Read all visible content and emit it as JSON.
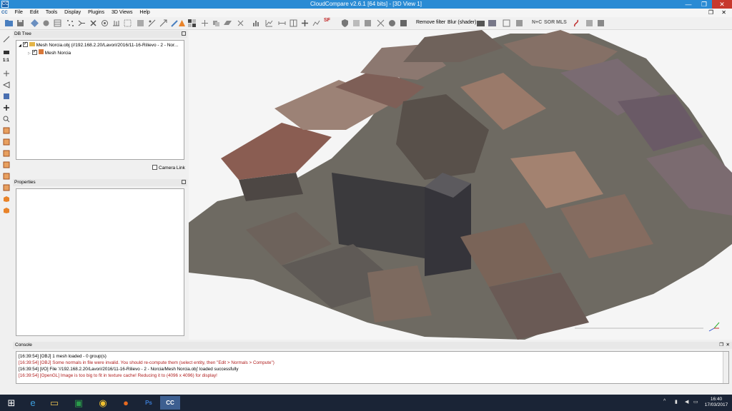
{
  "window": {
    "title": "CloudCompare v2.6.1 [64 bits] - [3D View 1]",
    "app_icon_text": "CC",
    "minimize": "—",
    "maximize": "❐",
    "close": "✕"
  },
  "menu": [
    "File",
    "Edit",
    "Tools",
    "Display",
    "Plugins",
    "3D Views",
    "Help"
  ],
  "toolbar": {
    "remove_filter_label": "Remove filter",
    "blur_shader_label": "Blur (shader)",
    "sf_label": "SF",
    "nc_label": "N+C",
    "sor_label": "SOR",
    "mls_label": "MLS"
  },
  "db_tree": {
    "title": "DB Tree",
    "root_label": "Mesh Norcia.obj (//192.168.2.20/Lavori/2016/11-16-Rilievo - 2 - Nor...",
    "child_label": "Mesh Norcia",
    "camera_link_label": "Camera Link"
  },
  "properties": {
    "title": "Properties"
  },
  "console": {
    "title": "Console",
    "lines": [
      {
        "text": "[16:39:54] [OBJ] 1 mesh loaded - 0 group(s)",
        "level": "info"
      },
      {
        "text": "[16:39:54] [OBJ] Some normals in file were invalid. You should re-compute them (select entity, then \"Edit > Normals > Compute\")",
        "level": "warning"
      },
      {
        "text": "[16:39:54] [I/O] File '//192.168.2.20/Lavori/2016/11-16-Rilievo - 2 - Norcia/Mesh Norcia.obj' loaded successfully",
        "level": "info"
      },
      {
        "text": "[16:39:54] [OpenGL] Image is too big to fit in texture cache! Reducing it to (4096 x 4096) for display!",
        "level": "warning"
      }
    ]
  },
  "taskbar": {
    "clock_time": "16:40",
    "clock_date": "17/03/2017",
    "apps": [
      "windows-start-icon",
      "internet-explorer-icon",
      "file-explorer-icon",
      "excel-icon",
      "chrome-icon",
      "firefox-icon",
      "photoshop-icon",
      "skype-icon",
      "cloudcompare-icon"
    ]
  },
  "colors": {
    "titlebar": "#2a8bd4",
    "taskbar": "#1a2436",
    "warning_text": "#b02020",
    "viewport_bg": "#f5f5f5"
  }
}
